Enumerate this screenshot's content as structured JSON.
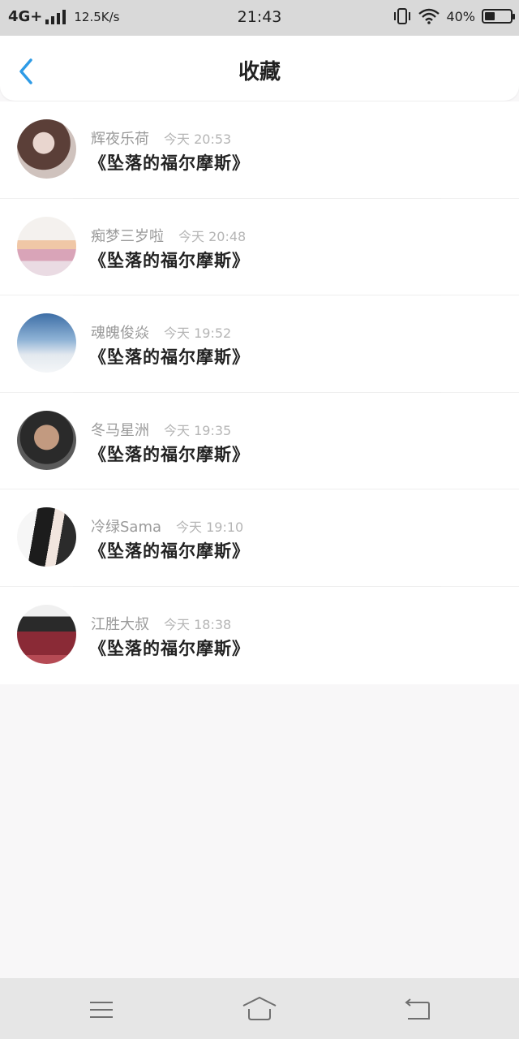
{
  "status_bar": {
    "network": "4G+",
    "speed": "12.5K/s",
    "time": "21:43",
    "battery_percent": "40%",
    "battery_level": 0.4
  },
  "header": {
    "title": "收藏",
    "back_icon": "chevron-left-icon",
    "accent_color": "#2e9be6"
  },
  "favorites": [
    {
      "user": "辉夜乐荷",
      "time": "今天 20:53",
      "title": "《坠落的福尔摩斯》"
    },
    {
      "user": "痴梦三岁啦",
      "time": "今天 20:48",
      "title": "《坠落的福尔摩斯》"
    },
    {
      "user": "魂魄俊焱",
      "time": "今天 19:52",
      "title": "《坠落的福尔摩斯》"
    },
    {
      "user": "冬马星洲",
      "time": "今天 19:35",
      "title": "《坠落的福尔摩斯》"
    },
    {
      "user": "冷绿Sama",
      "time": "今天 19:10",
      "title": "《坠落的福尔摩斯》"
    },
    {
      "user": "江胜大叔",
      "time": "今天 18:38",
      "title": "《坠落的福尔摩斯》"
    }
  ],
  "nav_bar": {
    "menu_icon": "menu-icon",
    "home_icon": "home-icon",
    "back_icon": "return-icon"
  }
}
